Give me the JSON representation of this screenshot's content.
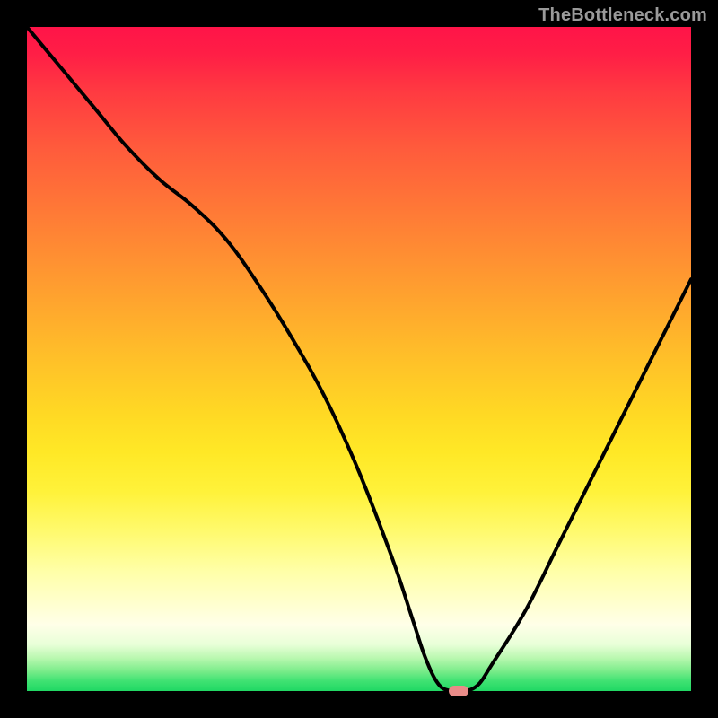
{
  "chart_data": {
    "type": "line",
    "title": "",
    "watermark": "TheBottleneck.com",
    "xlabel": "",
    "ylabel": "",
    "xlim": [
      0,
      100
    ],
    "ylim": [
      0,
      100
    ],
    "grid": false,
    "axes_visible": false,
    "background_gradient": "red-to-green vertical",
    "series": [
      {
        "name": "bottleneck-curve",
        "x": [
          0,
          5,
          10,
          15,
          20,
          25,
          30,
          35,
          40,
          45,
          50,
          55,
          58,
          60,
          62,
          64,
          66,
          68,
          70,
          75,
          80,
          85,
          90,
          95,
          100
        ],
        "values": [
          100,
          94,
          88,
          82,
          77,
          73,
          68,
          61,
          53,
          44,
          33,
          20,
          11,
          5,
          1,
          0,
          0,
          1,
          4,
          12,
          22,
          32,
          42,
          52,
          62
        ]
      }
    ],
    "marker": {
      "x": 65,
      "y": 0,
      "color": "#e98b88",
      "shape": "pill"
    }
  }
}
